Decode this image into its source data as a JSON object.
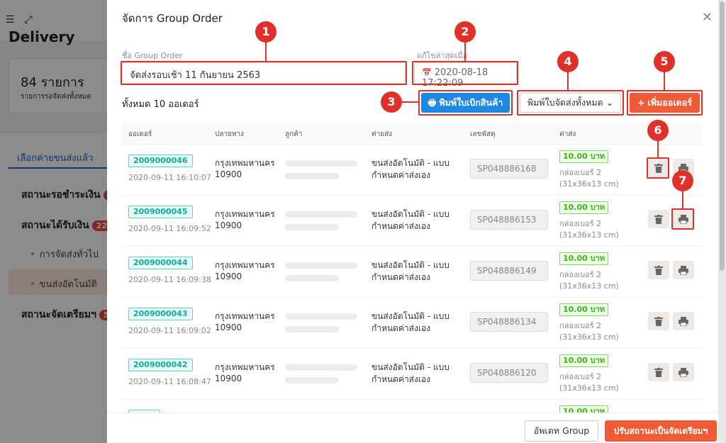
{
  "background": {
    "page_title": "Delivery",
    "summary_count": "84 รายการ",
    "summary_label": "รายการรอจัดส่งทั้งหมด",
    "tab_label": "เลือกค่ายขนส่งแล้ว",
    "statuses": [
      {
        "label": "สถานะรอชำระเงิน",
        "badge": "1"
      },
      {
        "label": "สถานะได้รับเงิน",
        "badge": "22"
      },
      {
        "label": "สถานะจัดเตรียมฯ",
        "badge": "5"
      }
    ],
    "sub_items": [
      "การจัดส่งทั่วไป",
      "ขนส่งอัตโนมัติ"
    ]
  },
  "modal": {
    "title": "จัดการ Group Order",
    "close_icon": "close-icon",
    "group_name_label": "ชื่อ Group Order",
    "group_name_value": "จัดส่งรอบเช้า 11 กันยายน 2563",
    "last_edited_label": "แก้ไขล่าสุดเมื่อ",
    "last_edited_value": "2020-08-18 17:22:09",
    "total_text": "ทั้งหมด 10 ออเดอร์",
    "print_pick_button": "พิมพ์ใบเบิกสินค้า",
    "print_all_button": "พิมพ์ใบจัดส่งทั้งหมด",
    "add_order_button": "เพิ่มออเดอร์",
    "columns": [
      "ออเดอร์",
      "ปลายทาง",
      "ลูกค้า",
      "ค่ายส่ง",
      "เลขพัสดุ",
      "ค่าส่ง"
    ],
    "orders": [
      {
        "id": "2009000046",
        "time": "2020-09-11 16:10:07",
        "dest1": "กรุงเทพมหานคร",
        "dest2": "10900",
        "ship1": "ขนส่งอัตโนมัติ - แบบ",
        "ship2": "กำหนดค่าส่งเอง",
        "tracking": "SP048886168",
        "price": "10.00 บาท",
        "box1": "กล่องเบอร์ 2",
        "box2": "(31x36x13 cm)"
      },
      {
        "id": "2009000045",
        "time": "2020-09-11 16:09:52",
        "dest1": "กรุงเทพมหานคร",
        "dest2": "10900",
        "ship1": "ขนส่งอัตโนมัติ - แบบ",
        "ship2": "กำหนดค่าส่งเอง",
        "tracking": "SP048886153",
        "price": "10.00 บาท",
        "box1": "กล่องเบอร์ 2",
        "box2": "(31x36x13 cm)"
      },
      {
        "id": "2009000044",
        "time": "2020-09-11 16:09:38",
        "dest1": "กรุงเทพมหานคร",
        "dest2": "10900",
        "ship1": "ขนส่งอัตโนมัติ - แบบ",
        "ship2": "กำหนดค่าส่งเอง",
        "tracking": "SP048886149",
        "price": "10.00 บาท",
        "box1": "กล่องเบอร์ 2",
        "box2": "(31x36x13 cm)"
      },
      {
        "id": "2009000043",
        "time": "2020-09-11 16:09:02",
        "dest1": "กรุงเทพมหานคร",
        "dest2": "10900",
        "ship1": "ขนส่งอัตโนมัติ - แบบ",
        "ship2": "กำหนดค่าส่งเอง",
        "tracking": "SP048886134",
        "price": "10.00 บาท",
        "box1": "กล่องเบอร์ 2",
        "box2": "(31x36x13 cm)"
      },
      {
        "id": "2009000042",
        "time": "2020-09-11 16:08:47",
        "dest1": "กรุงเทพมหานคร",
        "dest2": "10900",
        "ship1": "ขนส่งอัตโนมัติ - แบบ",
        "ship2": "กำหนดค่าส่งเอง",
        "tracking": "SP048886120",
        "price": "10.00 บาท",
        "box1": "กล่องเบอร์ 2",
        "box2": "(31x36x13 cm)"
      }
    ],
    "partial_row_price": "10.00 บาท",
    "update_group_button": "อัพเดท Group",
    "set_status_button": "ปรับสถานะเป็นจัดเตรียมฯ"
  },
  "annotations": [
    "1",
    "2",
    "3",
    "4",
    "5",
    "6",
    "7"
  ],
  "colors": {
    "accent_red": "#e0302a",
    "primary_blue": "#1e88e5",
    "add_orange": "#f05a36",
    "order_teal": "#13a89e",
    "price_green": "#3bb319"
  }
}
